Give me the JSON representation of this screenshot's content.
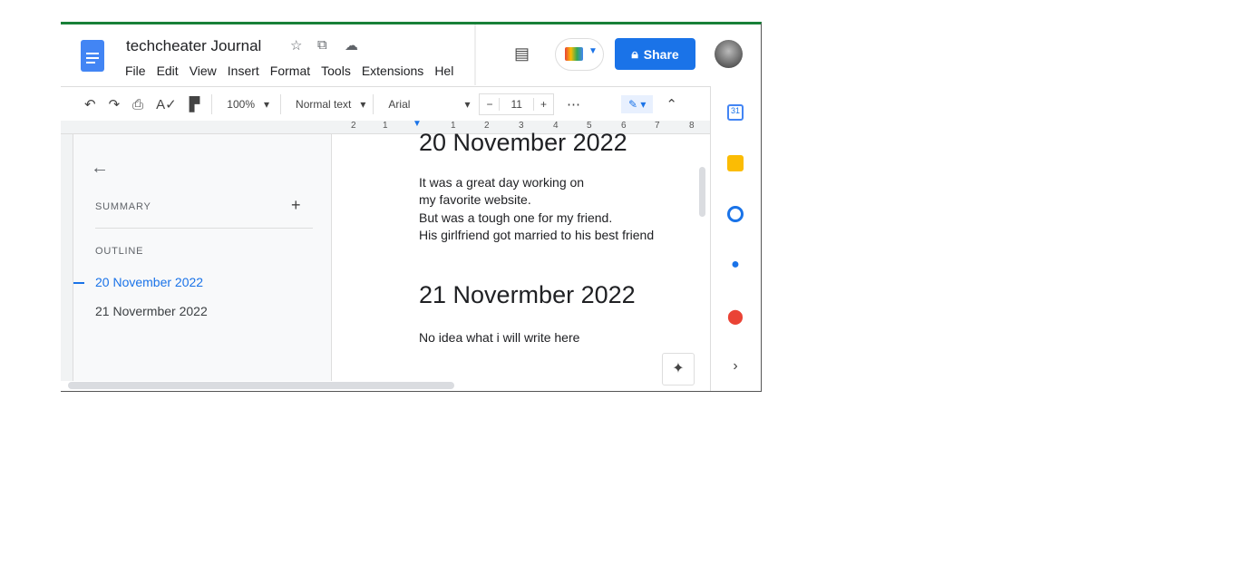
{
  "app": {
    "title": "techcheater Journal",
    "menu": [
      "File",
      "Edit",
      "View",
      "Insert",
      "Format",
      "Tools",
      "Extensions",
      "Hel"
    ],
    "share_label": "Share"
  },
  "toolbar": {
    "zoom": "100%",
    "style": "Normal text",
    "font": "Arial",
    "font_size": "11"
  },
  "ruler": [
    "2",
    "1",
    "1",
    "2",
    "3",
    "4",
    "5",
    "6",
    "7",
    "8"
  ],
  "outline": {
    "summary_label": "SUMMARY",
    "outline_label": "OUTLINE",
    "items": [
      "20 November 2022",
      "21 Novermber 2022"
    ]
  },
  "document": {
    "h1": "20 November 2022",
    "lines": [
      "It was a great day working on",
      "my favorite website.",
      "But was a tough one for my friend.",
      "His girlfriend got married to his best friend"
    ],
    "h2": "21 Novermber 2022",
    "line2": "No idea what i will write here"
  },
  "colors": {
    "accent": "#1a73e8",
    "border_top": "#188038"
  }
}
